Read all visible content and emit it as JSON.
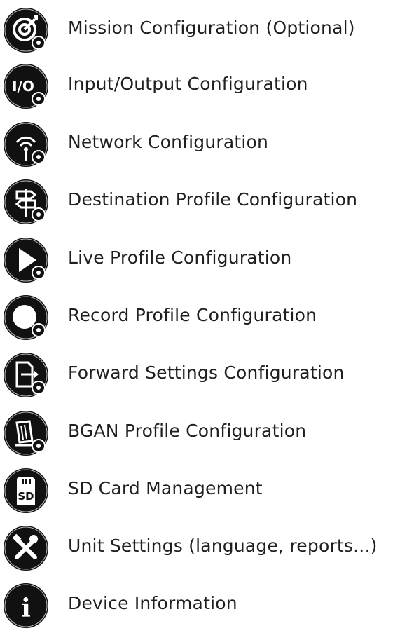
{
  "menu": {
    "items": [
      {
        "label": "Mission Configuration (Optional)",
        "icon": "mission-target-icon"
      },
      {
        "label": "Input/Output Configuration",
        "icon": "input-output-icon"
      },
      {
        "label": "Network Configuration",
        "icon": "network-wifi-icon"
      },
      {
        "label": "Destination Profile Configuration",
        "icon": "destination-signpost-icon"
      },
      {
        "label": "Live Profile Configuration",
        "icon": "live-play-icon"
      },
      {
        "label": "Record Profile Configuration",
        "icon": "record-circle-icon"
      },
      {
        "label": "Forward Settings Configuration",
        "icon": "forward-file-icon"
      },
      {
        "label": "BGAN Profile Configuration",
        "icon": "bgan-antenna-icon"
      },
      {
        "label": "SD Card Management",
        "icon": "sd-card-icon"
      },
      {
        "label": "Unit Settings (language, reports...)",
        "icon": "tools-icon"
      },
      {
        "label": "Device Information",
        "icon": "info-icon"
      }
    ],
    "icon_text": {
      "io": "I/O",
      "sd": "SD",
      "info": "i"
    },
    "colors": {
      "icon_fill": "#111111",
      "icon_glyph": "#ffffff",
      "text": "#1f1f1f"
    }
  }
}
